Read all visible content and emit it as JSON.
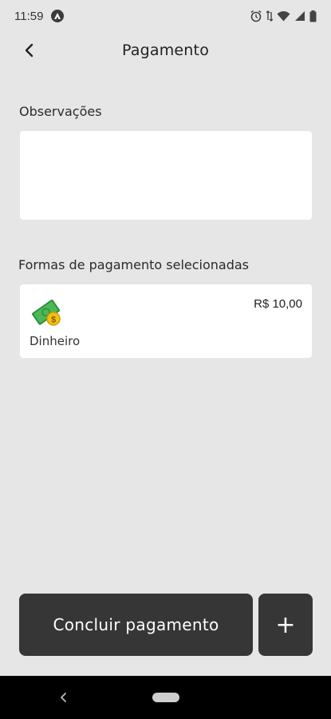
{
  "status_bar": {
    "time": "11:59",
    "icons": [
      "app-icon",
      "alarm-icon",
      "data-icon",
      "wifi-icon",
      "signal-icon",
      "battery-icon"
    ]
  },
  "header": {
    "title": "Pagamento",
    "back_icon": "chevron-left-icon"
  },
  "observacoes": {
    "label": "Observações",
    "value": ""
  },
  "formas": {
    "label": "Formas de pagamento selecionadas",
    "items": [
      {
        "method": "Dinheiro",
        "value": "R$ 10,00",
        "icon": "cash-money-icon"
      }
    ]
  },
  "actions": {
    "conclude_label": "Concluir pagamento",
    "add_label": "+"
  },
  "colors": {
    "background": "#e6e6e6",
    "button": "#363636",
    "card": "#ffffff",
    "money_green": "#3aa845",
    "coin_yellow": "#f5c211"
  }
}
